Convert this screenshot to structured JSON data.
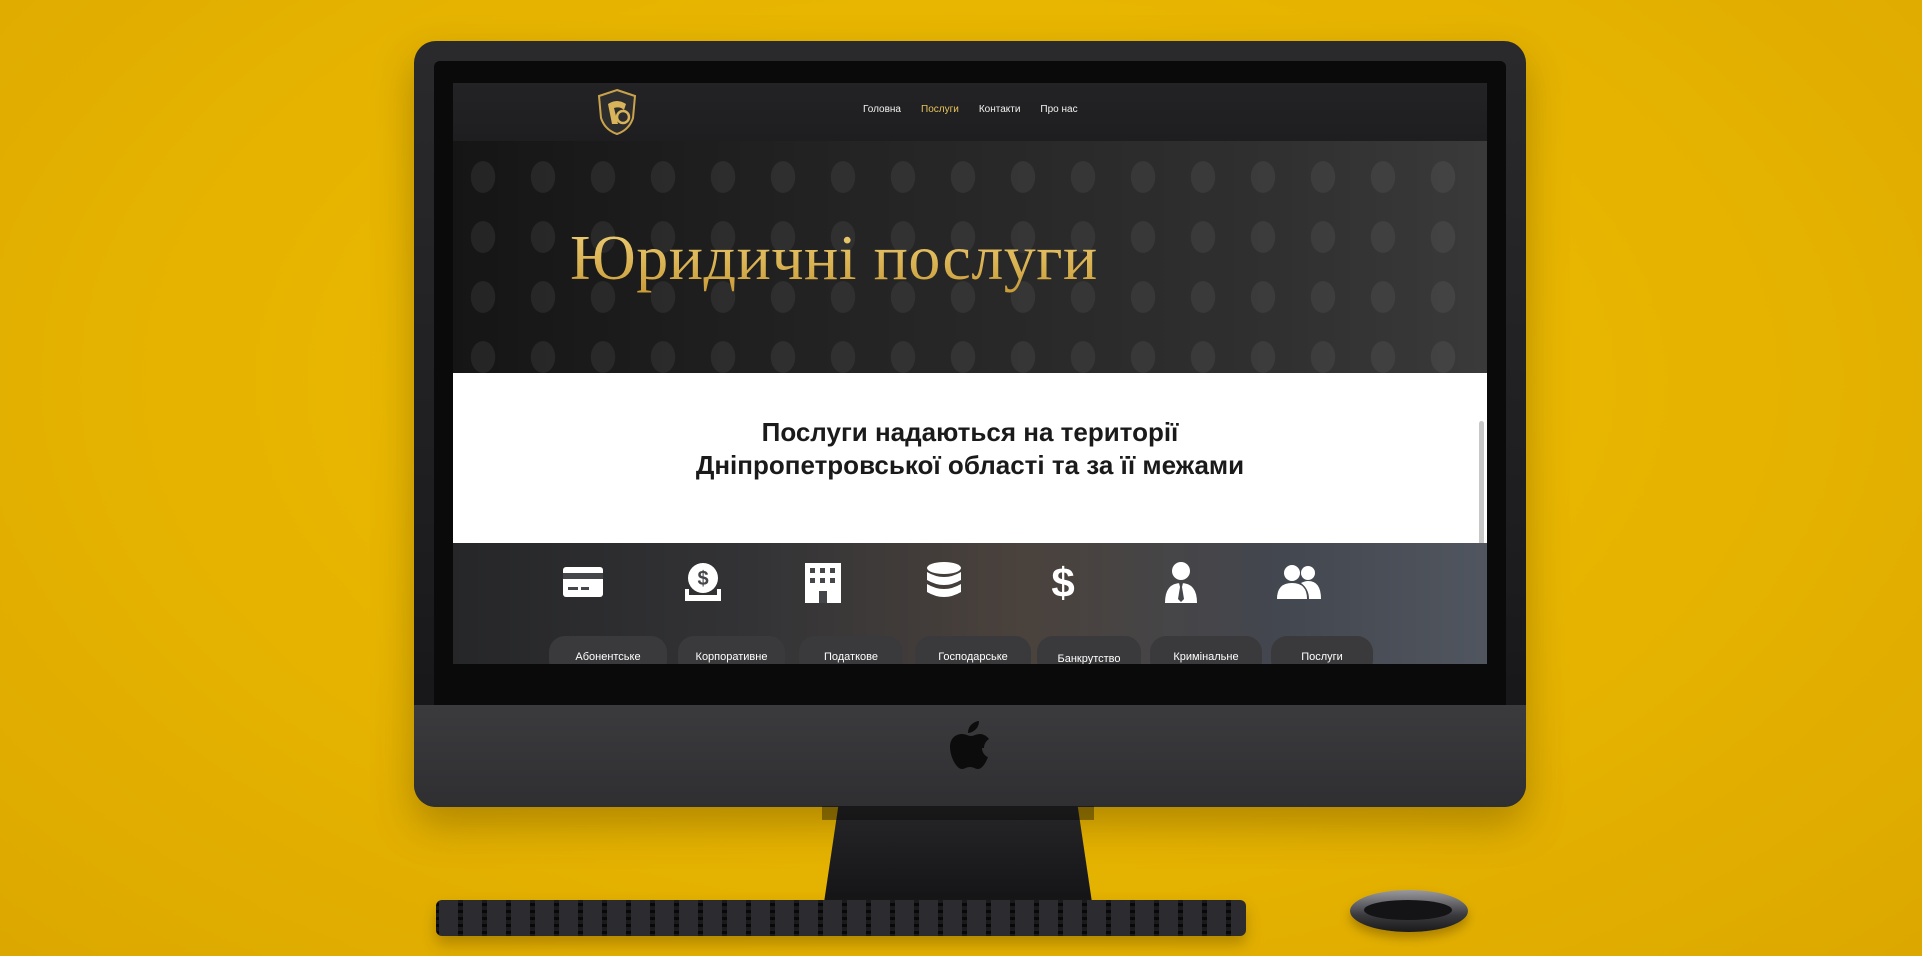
{
  "nav": {
    "items": [
      "Головна",
      "Послуги",
      "Контакти",
      "Про нас"
    ],
    "active": "Послуги"
  },
  "hero": {
    "title": "Юридичні послуги"
  },
  "intro": {
    "line1": "Послуги надаються на території",
    "line2": "Дніпропетровської області та за її межами"
  },
  "services": [
    {
      "icon": "credit-card-icon",
      "label": "Абонентське"
    },
    {
      "icon": "money-hand-icon",
      "label": "Корпоративне"
    },
    {
      "icon": "building-icon",
      "label": "Податкове"
    },
    {
      "icon": "database-coins-icon",
      "label": "Господарське"
    },
    {
      "icon": "dollar-icon",
      "label": "Банкрутство"
    },
    {
      "icon": "person-tie-icon",
      "label": "Кримінальне"
    },
    {
      "icon": "users-icon",
      "label": "Послуги"
    }
  ],
  "colors": {
    "background": "#e6b400",
    "accent_gold": "#e7c35a",
    "dark": "#1e1e20"
  }
}
